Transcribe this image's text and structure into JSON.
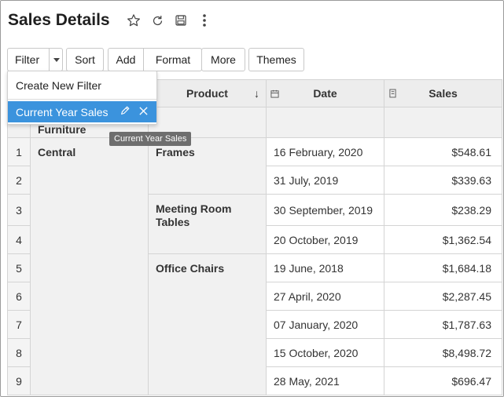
{
  "page": {
    "title": "Sales Details"
  },
  "toolbar": {
    "filter": "Filter",
    "sort": "Sort",
    "add": "Add",
    "format": "Format",
    "more": "More",
    "themes": "Themes"
  },
  "filter_menu": {
    "create_new": "Create New Filter",
    "current": "Current Year Sales",
    "tooltip": "Current Year Sales"
  },
  "table": {
    "headers": {
      "product": "Product",
      "date": "Date",
      "sales": "Sales"
    },
    "group": "Furniture",
    "region": "Central",
    "products": [
      "Frames",
      "Meeting Room Tables",
      "Office Chairs"
    ],
    "rows": [
      {
        "num": "1",
        "date": "16 February, 2020",
        "sales": "$548.61"
      },
      {
        "num": "2",
        "date": "31 July, 2019",
        "sales": "$339.63"
      },
      {
        "num": "3",
        "date": "30 September, 2019",
        "sales": "$238.29"
      },
      {
        "num": "4",
        "date": "20 October, 2019",
        "sales": "$1,362.54"
      },
      {
        "num": "5",
        "date": "19 June, 2018",
        "sales": "$1,684.18"
      },
      {
        "num": "6",
        "date": "27 April, 2020",
        "sales": "$2,287.45"
      },
      {
        "num": "7",
        "date": "07 January, 2020",
        "sales": "$1,787.63"
      },
      {
        "num": "8",
        "date": "15 October, 2020",
        "sales": "$8,498.72"
      },
      {
        "num": "9",
        "date": "28 May, 2021",
        "sales": "$696.47"
      }
    ]
  },
  "colors": {
    "accent": "#3b93dd",
    "header_bg": "#ededed",
    "tooltip_bg": "#6e6e6e"
  }
}
